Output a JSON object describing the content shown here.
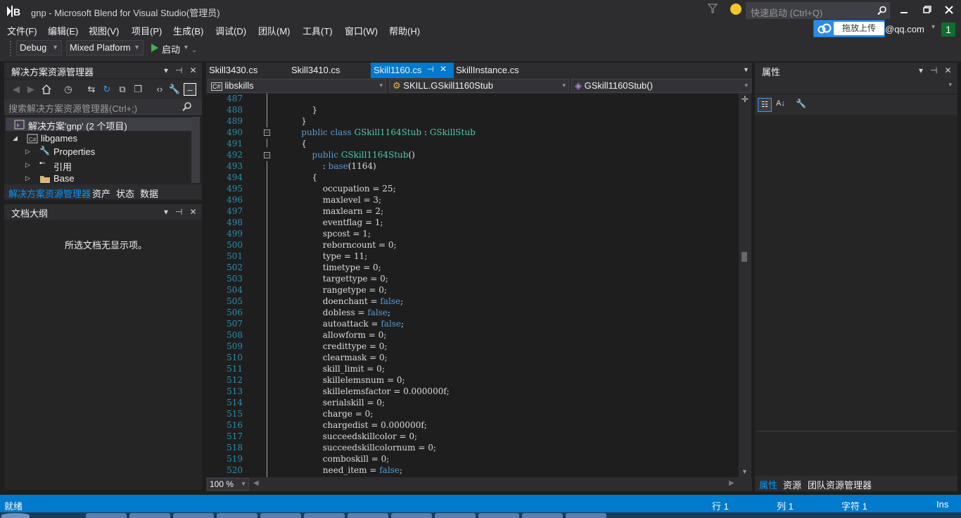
{
  "window": {
    "title": "gnp - Microsoft Blend for Visual Studio(管理员)",
    "quick_launch_placeholder": "快速启动 (Ctrl+Q)",
    "account": "@qq.com",
    "notification_count": "1",
    "upload_label": "拖放上传"
  },
  "menu": [
    "文件(F)",
    "编辑(E)",
    "视图(V)",
    "项目(P)",
    "生成(B)",
    "调试(D)",
    "团队(M)",
    "工具(T)",
    "窗口(W)",
    "帮助(H)"
  ],
  "toolbar": {
    "config": "Debug",
    "platform": "Mixed Platform",
    "start": "启动"
  },
  "solution_explorer": {
    "title": "解决方案资源管理器",
    "search_placeholder": "搜索解决方案资源管理器(Ctrl+;)",
    "tree": [
      {
        "label": "解决方案'gnp' (2 个项目)",
        "icon": "solution-icon"
      },
      {
        "label": "libgames",
        "icon": "csharp-project-icon"
      },
      {
        "label": "Properties",
        "icon": "wrench-icon"
      },
      {
        "label": "引用",
        "icon": "references-icon"
      },
      {
        "label": "Base",
        "icon": "folder-icon"
      }
    ],
    "tabs": [
      "解决方案资源管理器",
      "资产",
      "状态",
      "数据"
    ]
  },
  "document_outline": {
    "title": "文档大纲",
    "empty_message": "所选文档无显示项。"
  },
  "editor": {
    "tabs": [
      "Skill3430.cs",
      "Skill3410.cs",
      "Skill1160.cs",
      "SkillInstance.cs"
    ],
    "active_tab": "Skill1160.cs",
    "nav": {
      "project": "libskills",
      "class": "SKILL.GSkill1160Stub",
      "member": "GSkill1160Stub()"
    },
    "zoom": "100 %",
    "lines": [
      {
        "n": "487",
        "t": ""
      },
      {
        "n": "488",
        "t": "        }"
      },
      {
        "n": "489",
        "t": "    }"
      },
      {
        "n": "490",
        "t": "    public class GSkill1164Stub : GSkillStub"
      },
      {
        "n": "491",
        "t": "    {"
      },
      {
        "n": "492",
        "t": "        public GSkill1164Stub()"
      },
      {
        "n": "493",
        "t": "            : base(1164)"
      },
      {
        "n": "494",
        "t": "        {"
      },
      {
        "n": "495",
        "t": "            occupation = 25;"
      },
      {
        "n": "496",
        "t": "            maxlevel = 3;"
      },
      {
        "n": "497",
        "t": "            maxlearn = 2;"
      },
      {
        "n": "498",
        "t": "            eventflag = 1;"
      },
      {
        "n": "499",
        "t": "            spcost = 1;"
      },
      {
        "n": "500",
        "t": "            reborncount = 0;"
      },
      {
        "n": "501",
        "t": "            type = 11;"
      },
      {
        "n": "502",
        "t": "            timetype = 0;"
      },
      {
        "n": "503",
        "t": "            targettype = 0;"
      },
      {
        "n": "504",
        "t": "            rangetype = 0;"
      },
      {
        "n": "505",
        "t": "            doenchant = false;"
      },
      {
        "n": "506",
        "t": "            dobless = false;"
      },
      {
        "n": "507",
        "t": "            autoattack = false;"
      },
      {
        "n": "508",
        "t": "            allowform = 0;"
      },
      {
        "n": "509",
        "t": "            credittype = 0;"
      },
      {
        "n": "510",
        "t": "            clearmask = 0;"
      },
      {
        "n": "511",
        "t": "            skill_limit = 0;"
      },
      {
        "n": "512",
        "t": "            skillelemsnum = 0;"
      },
      {
        "n": "513",
        "t": "            skillelemsfactor = 0.000000f;"
      },
      {
        "n": "514",
        "t": "            serialskill = 0;"
      },
      {
        "n": "515",
        "t": "            charge = 0;"
      },
      {
        "n": "516",
        "t": "            chargedist = 0.000000f;"
      },
      {
        "n": "517",
        "t": "            succeedskillcolor = 0;"
      },
      {
        "n": "518",
        "t": "            succeedskillcolornum = 0;"
      },
      {
        "n": "519",
        "t": "            comboskill = 0;"
      },
      {
        "n": "520",
        "t": "            need_item = false;"
      }
    ]
  },
  "properties": {
    "title": "属性",
    "tabs": [
      "属性",
      "资源",
      "团队资源管理器"
    ]
  },
  "status": {
    "ready": "就绪",
    "line": "行 1",
    "col": "列 1",
    "char": "字符 1",
    "mode": "Ins"
  },
  "colors": {
    "accent": "#007acc",
    "keyword": "#569cd6",
    "type": "#4ec9b0",
    "line_number": "#2b91af"
  }
}
